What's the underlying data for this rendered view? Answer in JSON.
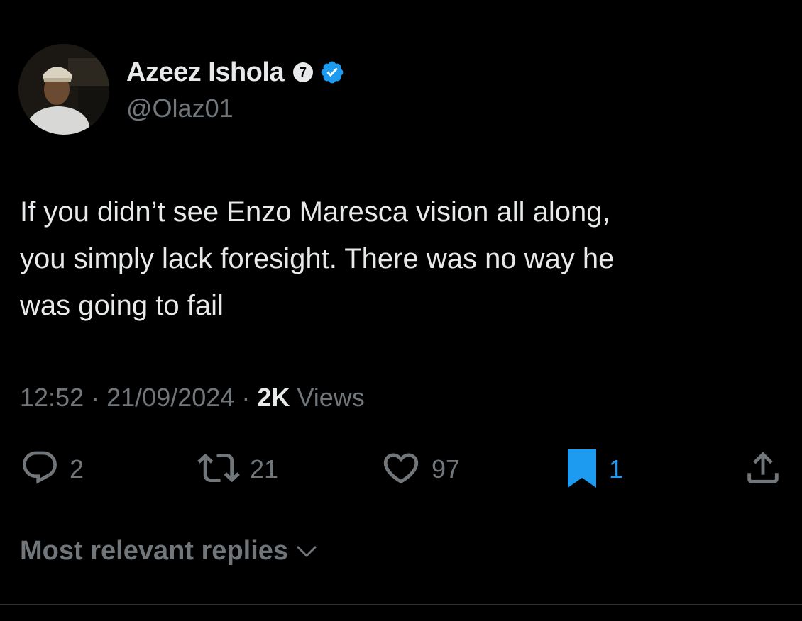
{
  "author": {
    "display_name": "Azeez Ishola",
    "badge_number": "7",
    "handle": "@Olaz01"
  },
  "tweet": {
    "lines": [
      "If you didn’t see Enzo Maresca vision all along,",
      "you simply lack foresight. There was no way he",
      "was going to fail"
    ]
  },
  "meta": {
    "time": "12:52",
    "separator": "·",
    "date": "21/09/2024",
    "views_count": "2K",
    "views_label": "Views"
  },
  "actions": {
    "replies": "2",
    "reposts": "21",
    "likes": "97",
    "bookmarks": "1"
  },
  "replies_sort": {
    "label": "Most relevant replies"
  },
  "colors": {
    "background": "#000000",
    "text_primary": "#e7e9ea",
    "text_secondary": "#71767b",
    "accent": "#1d9bf0"
  }
}
